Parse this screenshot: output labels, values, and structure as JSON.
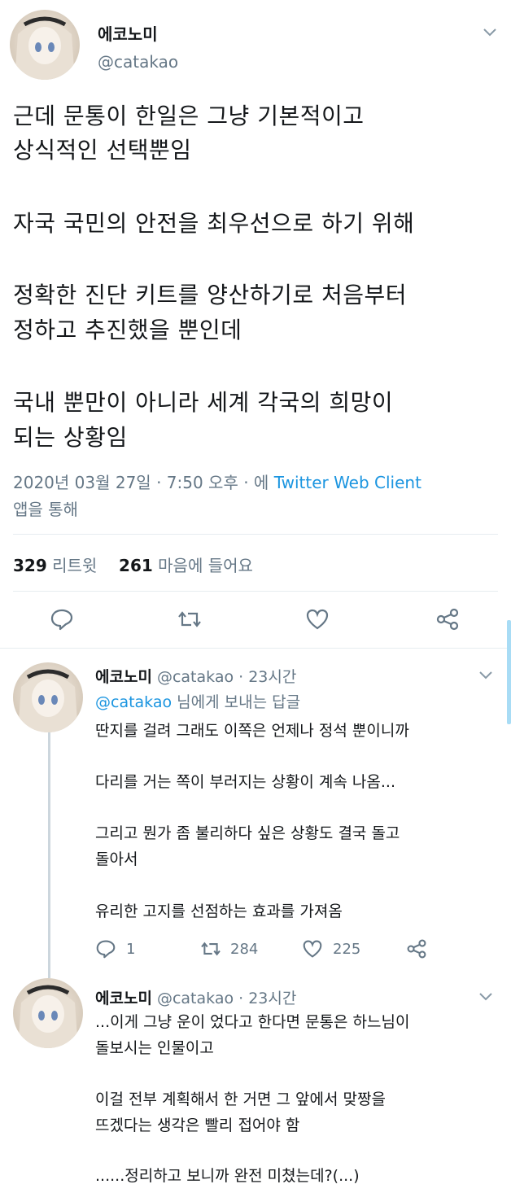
{
  "main_tweet": {
    "author_name": "에코노미",
    "author_handle": "@catakao",
    "paragraphs": [
      [
        "근데 문통이 한일은 그냥 기본적이고",
        "상식적인 선택뿐임"
      ],
      [
        "자국 국민의 안전을 최우선으로 하기 위해"
      ],
      [
        "정확한 진단 키트를 양산하기로 처음부터",
        "정하고 추진했을 뿐인데"
      ],
      [
        "국내 뿐만이 아니라 세계 각국의 희망이",
        "되는 상황임"
      ]
    ],
    "timestamp": "2020년 03월 27일 · 7:50 오후 · 에",
    "client": "Twitter Web Client",
    "client_suffix": "앱을 통해",
    "retweet_count": "329",
    "retweet_label": "리트윗",
    "like_count": "261",
    "like_label": "마음에 들어요",
    "icons": [
      "reply-icon",
      "retweet-icon",
      "like-icon",
      "share-icon",
      "chevron-down-icon"
    ]
  },
  "replies": [
    {
      "author_name": "에코노미",
      "author_handle": "@catakao",
      "time": "· 23시간",
      "reply_to_handle": "@catakao",
      "reply_to_suffix": "님에게 보내는 답글",
      "paragraphs": [
        [
          "딴지를 걸려 그래도 이쪽은 언제나 정석 뿐이니까"
        ],
        [
          "다리를 거는 쪽이 부러지는 상황이 계속 나옴..."
        ],
        [
          "그리고 뭔가 좀 불리하다 싶은 상황도 결국 돌고",
          "돌아서"
        ],
        [
          "유리한 고지를 선점하는 효과를 가져옴"
        ]
      ],
      "reply_count": "1",
      "retweet_count": "284",
      "like_count": "225"
    },
    {
      "author_name": "에코노미",
      "author_handle": "@catakao",
      "time": "· 23시간",
      "paragraphs": [
        [
          "...이게 그냥 운이 었다고 한다면 문통은 하느님이",
          "돌보시는 인물이고"
        ],
        [
          "이걸 전부 계획해서 한 거면 그 앞에서 맞짱을",
          "뜨겠다는 생각은 빨리 접어야 함"
        ],
        [
          "......정리하고 보니까 완전 미쳤는데?(...)"
        ]
      ]
    }
  ],
  "colors": {
    "text": "#14171a",
    "secondary": "#657786",
    "link": "#1b95e0",
    "divider": "#e6ecf0"
  }
}
